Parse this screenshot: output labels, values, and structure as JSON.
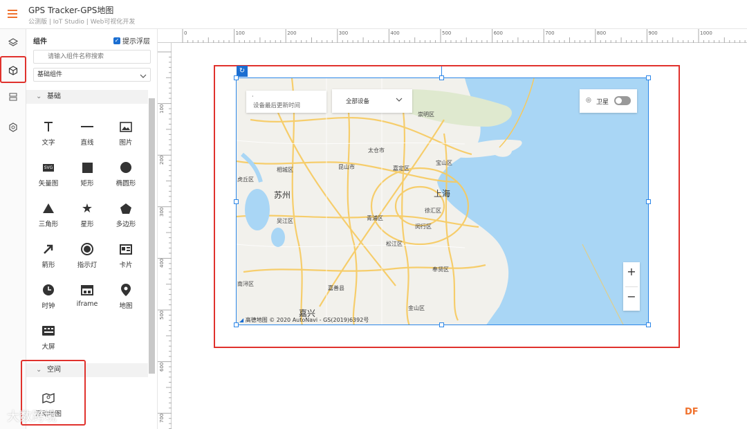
{
  "app": {
    "title": "GPS Tracker-GPS地图",
    "subtitle": "公测版 | IoT Studio | Web可视化开发"
  },
  "panel": {
    "title": "组件",
    "hint_label": "提示浮层",
    "search_placeholder": "请输入组件名称搜索",
    "category_select": "基础组件",
    "section_basic": "基础",
    "section_space": "空间",
    "components": [
      "文字",
      "直线",
      "图片",
      "矢量图",
      "矩形",
      "椭圆形",
      "三角形",
      "星形",
      "多边形",
      "箭形",
      "指示灯",
      "卡片",
      "时钟",
      "iframe",
      "地图",
      "大屏"
    ],
    "space_components": [
      "浮动地图"
    ]
  },
  "ruler": {
    "top_ticks": [
      "0",
      "100",
      "200",
      "300",
      "400",
      "500",
      "600",
      "700",
      "800",
      "900",
      "1000"
    ],
    "left_ticks": [
      "100",
      "200",
      "300",
      "400",
      "500",
      "600",
      "700"
    ]
  },
  "map": {
    "time_label": "设备最后更新时间",
    "device_select": "全部设备",
    "satellite_label": "卫星",
    "zoom_in": "+",
    "zoom_out": "−",
    "copyright": "高德地图 © 2020 AutoNavi - GS(2019)6392号",
    "cities": [
      "崇明区",
      "太仓市",
      "宝山区",
      "相城区",
      "昆山市",
      "嘉定区",
      "虎丘区",
      "苏州",
      "上海",
      "吴江区",
      "青浦区",
      "徐汇区",
      "闵行区",
      "松江区",
      "奉贤区",
      "吴江区",
      "嘉善县",
      "嘉兴",
      "金山区",
      "南浔区"
    ]
  },
  "watermark": {
    "df": "DF",
    "brand": "大数跨境"
  },
  "colors": {
    "accent": "#f0712c",
    "select_blue": "#2b86e8",
    "highlight_red": "#e0312c",
    "water": "#a9d6f5",
    "land": "#f2f1ec",
    "road": "#f7ca5e"
  }
}
